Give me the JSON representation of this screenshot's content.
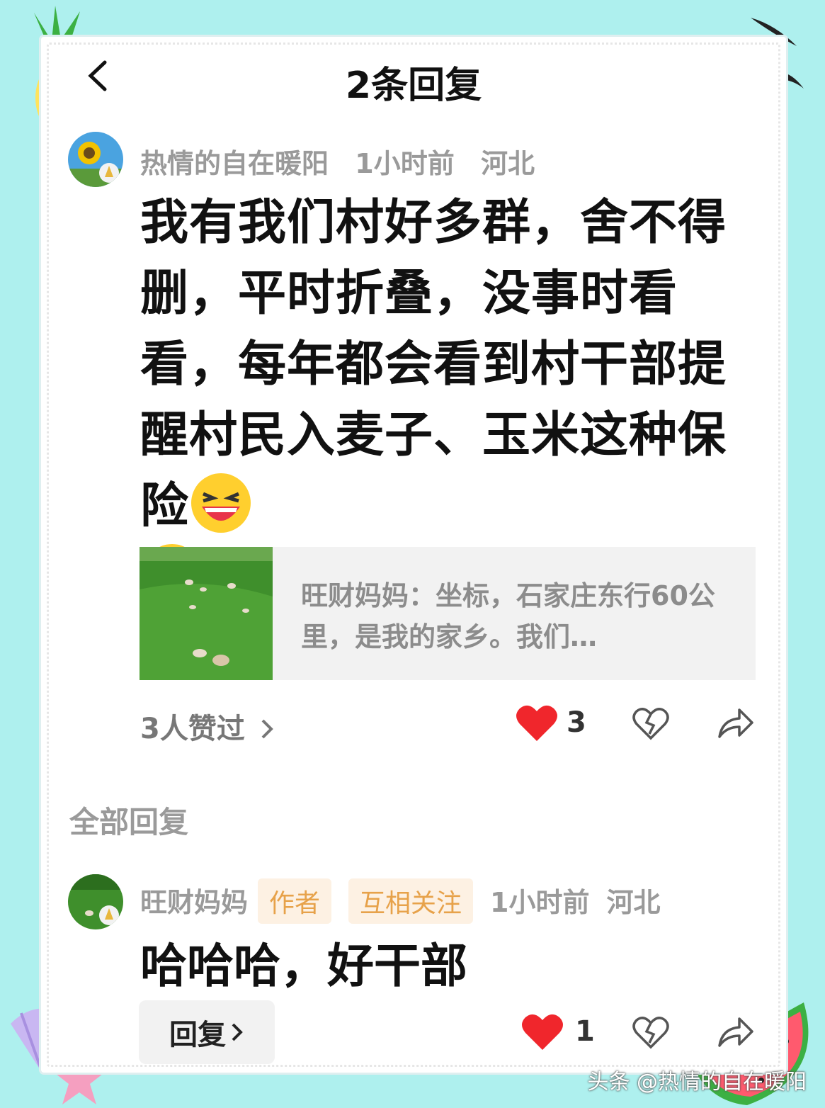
{
  "header": {
    "title": "2条回复"
  },
  "comment": {
    "author": "热情的自在暖阳",
    "time": "1小时前",
    "location": "河北",
    "text": "我有我们村好多群，舍不得删，平时折叠，没事时看看，每年都会看到村干部提醒村民入麦子、玉米这种保险",
    "quote": "旺财妈妈：坐标，石家庄东行60公里，是我的家乡。我们…",
    "likes_link": "3人赞过",
    "like_count": "3"
  },
  "section_title": "全部回复",
  "reply": {
    "author": "旺财妈妈",
    "badge_author": "作者",
    "badge_follow": "互相关注",
    "time": "1小时前",
    "location": "河北",
    "text": "哈哈哈，好干部",
    "like_count": "1",
    "reply_label": "回复"
  },
  "watermark": "头条 @热情的自在暖阳",
  "colors": {
    "background": "#aef0ee",
    "like_red": "#f0262c",
    "badge_text": "#e7a24a"
  },
  "icons": [
    "back-icon",
    "heart-filled-icon",
    "broken-heart-icon",
    "share-icon",
    "chevron-right-icon",
    "laughing-emoji-icon"
  ]
}
